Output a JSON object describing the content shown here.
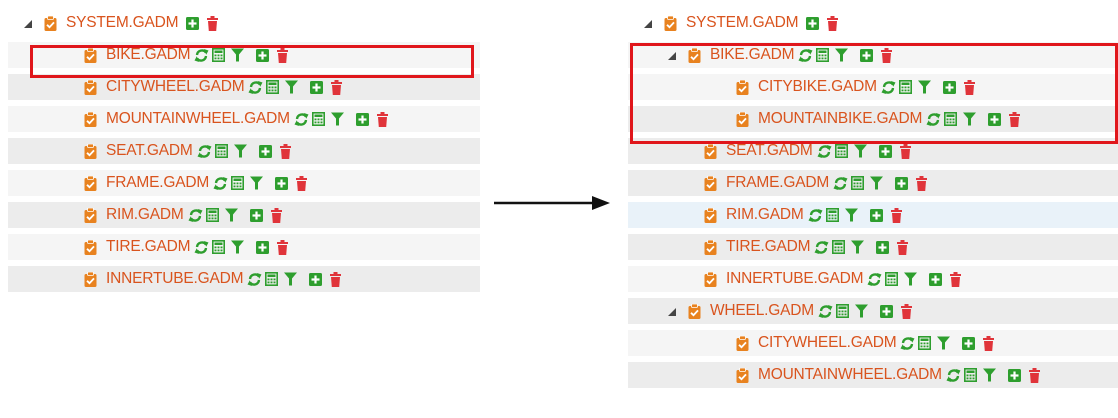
{
  "left_tree": {
    "root": {
      "label": "SYSTEM.GADM",
      "expanded": true
    },
    "children": [
      {
        "label": "BIKE.GADM",
        "highlighted": true
      },
      {
        "label": "CITYWHEEL.GADM"
      },
      {
        "label": "MOUNTAINWHEEL.GADM"
      },
      {
        "label": "SEAT.GADM"
      },
      {
        "label": "FRAME.GADM"
      },
      {
        "label": "RIM.GADM"
      },
      {
        "label": "TIRE.GADM"
      },
      {
        "label": "INNERTUBE.GADM"
      }
    ]
  },
  "right_tree": {
    "root": {
      "label": "SYSTEM.GADM",
      "expanded": true
    },
    "children": [
      {
        "label": "BIKE.GADM",
        "expanded": true,
        "highlighted": true,
        "children": [
          {
            "label": "CITYBIKE.GADM"
          },
          {
            "label": "MOUNTAINBIKE.GADM"
          }
        ]
      },
      {
        "label": "SEAT.GADM"
      },
      {
        "label": "FRAME.GADM"
      },
      {
        "label": "RIM.GADM"
      },
      {
        "label": "TIRE.GADM"
      },
      {
        "label": "INNERTUBE.GADM"
      },
      {
        "label": "WHEEL.GADM",
        "expanded": true,
        "children": [
          {
            "label": "CITYWHEEL.GADM"
          },
          {
            "label": "MOUNTAINWHEEL.GADM"
          }
        ]
      }
    ]
  },
  "icons": {
    "node": "clipboard-check-icon",
    "refresh": "refresh-icon",
    "calculator": "calculator-icon",
    "filter": "filter-icon",
    "add": "plus-square-icon",
    "delete": "trash-icon",
    "expand": "caret-expanded-icon"
  },
  "colors": {
    "label_text": "#d9541e",
    "node_icon": "#e8821f",
    "action_icon": "#2e9e2e",
    "delete_icon": "#e0343a",
    "highlight_border": "#e0161b",
    "row_shade": "#ececec",
    "row_blue": "#e9f2f9"
  }
}
